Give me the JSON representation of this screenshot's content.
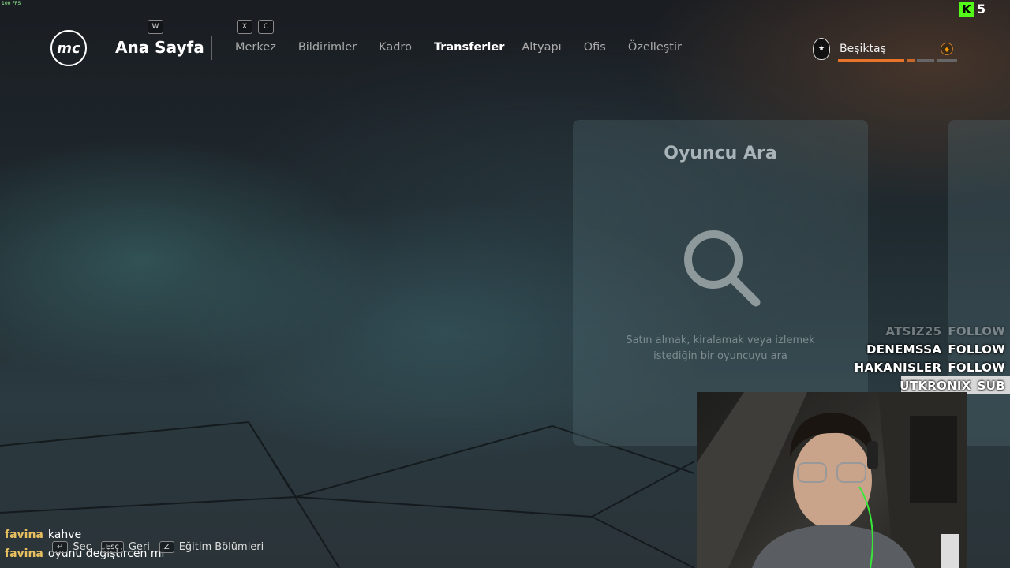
{
  "overlay": {
    "fps": "100 FPS",
    "kick_count": "5"
  },
  "header": {
    "logo": "mc",
    "home_title": "Ana Sayfa",
    "home_key": "W",
    "prev_key": "X",
    "next_key": "C",
    "tabs": [
      {
        "label": "Merkez"
      },
      {
        "label": "Bildirimler"
      },
      {
        "label": "Kadro"
      },
      {
        "label": "Transferler"
      },
      {
        "label": "Altyapı"
      },
      {
        "label": "Ofis"
      },
      {
        "label": "Özelleştir"
      }
    ],
    "active_tab": "Transferler",
    "club_name": "Beşiktaş",
    "club_progress": 0.55
  },
  "search_card": {
    "title": "Oyuncu Ara",
    "description_line1": "Satın almak, kiralamak veya izlemek",
    "description_line2": "istediğin bir oyuncuyu ara"
  },
  "alerts": [
    {
      "user": "ATSIZ25",
      "action": "FOLLOW",
      "faded": true
    },
    {
      "user": "DENEMSSA",
      "action": "FOLLOW",
      "faded": false
    },
    {
      "user": "HAKANISLER",
      "action": "FOLLOW",
      "faded": false
    },
    {
      "user": "UTKRONIX",
      "action": "SUB",
      "faded": false
    }
  ],
  "chat": [
    {
      "user": "favina",
      "message": "kahve"
    },
    {
      "user": "favina",
      "message": "oyunu değiştircen mi"
    }
  ],
  "hints": [
    {
      "key": "↵",
      "label": "Seç"
    },
    {
      "key": "Esc",
      "label": "Geri"
    },
    {
      "key": "Z",
      "label": "Eğitim Bölümleri"
    }
  ],
  "colors": {
    "accent_orange": "#e8742a",
    "kick_green": "#53fc18",
    "chat_user": "#e8c060"
  }
}
